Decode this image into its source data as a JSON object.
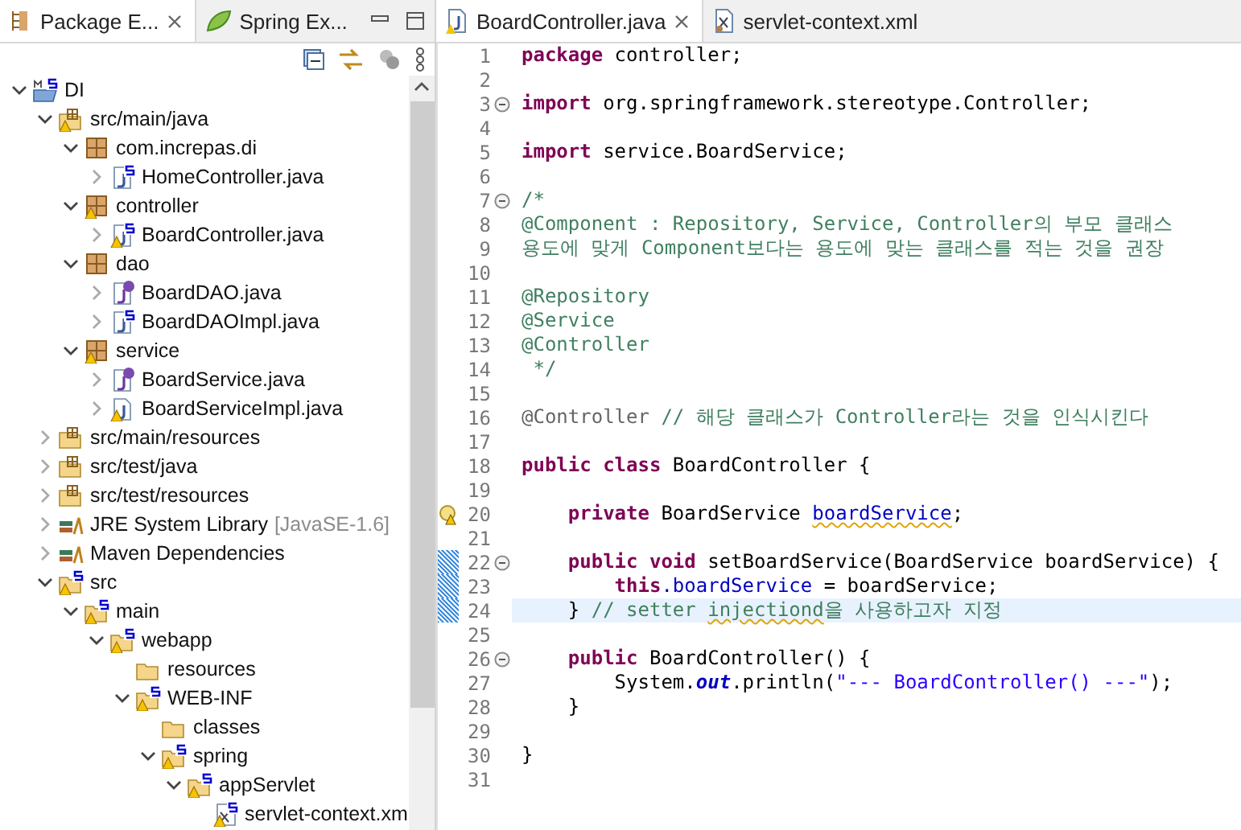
{
  "explorer": {
    "tabs": [
      {
        "label": "Package E...",
        "selected": true,
        "kind": "package"
      },
      {
        "label": "Spring Ex...",
        "selected": false,
        "kind": "spring"
      }
    ],
    "tree": [
      {
        "label": "DI",
        "kind": "project",
        "expanded": true,
        "children": [
          {
            "label": "src/main/java",
            "kind": "source-folder",
            "warning": true,
            "expanded": true,
            "children": [
              {
                "label": "com.increpas.di",
                "kind": "package",
                "expanded": true,
                "children": [
                  {
                    "label": "HomeController.java",
                    "kind": "java-class",
                    "expanded": false
                  }
                ]
              },
              {
                "label": "controller",
                "kind": "package",
                "warning": true,
                "expanded": true,
                "children": [
                  {
                    "label": "BoardController.java",
                    "kind": "java-class",
                    "warning": true,
                    "expanded": false
                  }
                ]
              },
              {
                "label": "dao",
                "kind": "package",
                "expanded": true,
                "children": [
                  {
                    "label": "BoardDAO.java",
                    "kind": "java-interface",
                    "expanded": false
                  },
                  {
                    "label": "BoardDAOImpl.java",
                    "kind": "java-class",
                    "expanded": false
                  }
                ]
              },
              {
                "label": "service",
                "kind": "package",
                "warning": true,
                "expanded": true,
                "children": [
                  {
                    "label": "BoardService.java",
                    "kind": "java-interface",
                    "expanded": false
                  },
                  {
                    "label": "BoardServiceImpl.java",
                    "kind": "java-file",
                    "warning": true,
                    "expanded": false
                  }
                ]
              }
            ]
          },
          {
            "label": "src/main/resources",
            "kind": "source-folder",
            "expanded": false
          },
          {
            "label": "src/test/java",
            "kind": "source-folder",
            "expanded": false
          },
          {
            "label": "src/test/resources",
            "kind": "source-folder",
            "expanded": false
          },
          {
            "label": "JRE System Library",
            "decoration": "[JavaSE-1.6]",
            "kind": "library",
            "expanded": false
          },
          {
            "label": "Maven Dependencies",
            "kind": "library",
            "expanded": false
          },
          {
            "label": "src",
            "kind": "spring-folder",
            "warning": true,
            "expanded": true,
            "children": [
              {
                "label": "main",
                "kind": "spring-folder",
                "warning": true,
                "expanded": true,
                "children": [
                  {
                    "label": "webapp",
                    "kind": "spring-folder",
                    "warning": true,
                    "expanded": true,
                    "children": [
                      {
                        "label": "resources",
                        "kind": "folder"
                      },
                      {
                        "label": "WEB-INF",
                        "kind": "spring-folder",
                        "warning": true,
                        "expanded": true,
                        "children": [
                          {
                            "label": "classes",
                            "kind": "folder"
                          },
                          {
                            "label": "spring",
                            "kind": "spring-folder",
                            "warning": true,
                            "expanded": true,
                            "children": [
                              {
                                "label": "appServlet",
                                "kind": "spring-folder",
                                "warning": true,
                                "expanded": true,
                                "children": [
                                  {
                                    "label": "servlet-context.xm",
                                    "kind": "xml",
                                    "warning": true
                                  }
                                ]
                              }
                            ]
                          }
                        ]
                      }
                    ]
                  }
                ]
              }
            ]
          }
        ]
      }
    ]
  },
  "editor": {
    "tabs": [
      {
        "label": "BoardController.java",
        "selected": true,
        "kind": "java"
      },
      {
        "label": "servlet-context.xml",
        "selected": false,
        "kind": "xml"
      }
    ],
    "lines": [
      {
        "number": "1",
        "tokens": [
          {
            "kind": "keyword",
            "text": "package"
          },
          {
            "kind": "plain",
            "text": " controller;"
          }
        ]
      },
      {
        "number": "2"
      },
      {
        "number": "3",
        "fold": true,
        "tokens": [
          {
            "kind": "keyword",
            "text": "import"
          },
          {
            "kind": "plain",
            "text": " org.springframework.stereotype.Controller;"
          }
        ]
      },
      {
        "number": "4"
      },
      {
        "number": "5",
        "tokens": [
          {
            "kind": "keyword",
            "text": "import"
          },
          {
            "kind": "plain",
            "text": " service.BoardService;"
          }
        ]
      },
      {
        "number": "6"
      },
      {
        "number": "7",
        "fold": true,
        "tokens": [
          {
            "kind": "comment",
            "text": "/*"
          }
        ]
      },
      {
        "number": "8",
        "tokens": [
          {
            "kind": "comment",
            "text": "@Component : Repository, Service, Controller의 부모 클래스"
          }
        ]
      },
      {
        "number": "9",
        "tokens": [
          {
            "kind": "comment",
            "text": "용도에 맞게 Component보다는 용도에 맞는 클래스를 적는 것을 권장"
          }
        ]
      },
      {
        "number": "10"
      },
      {
        "number": "11",
        "tokens": [
          {
            "kind": "comment",
            "text": "@Repository"
          }
        ]
      },
      {
        "number": "12",
        "tokens": [
          {
            "kind": "comment",
            "text": "@Service"
          }
        ]
      },
      {
        "number": "13",
        "tokens": [
          {
            "kind": "comment",
            "text": "@Controller"
          }
        ]
      },
      {
        "number": "14",
        "tokens": [
          {
            "kind": "comment",
            "text": " */"
          }
        ]
      },
      {
        "number": "15"
      },
      {
        "number": "16",
        "tokens": [
          {
            "kind": "annotation",
            "text": "@Controller"
          },
          {
            "kind": "comment",
            "text": " // 해당 클래스가 Controller라는 것을 인식시킨다"
          }
        ]
      },
      {
        "number": "17"
      },
      {
        "number": "18",
        "tokens": [
          {
            "kind": "keyword",
            "text": "public class"
          },
          {
            "kind": "plain",
            "text": " BoardController {"
          }
        ]
      },
      {
        "number": "19"
      },
      {
        "number": "20",
        "warning": true,
        "tokens": [
          {
            "kind": "keyword",
            "text": "    private"
          },
          {
            "kind": "plain",
            "text": " BoardService "
          },
          {
            "kind": "field",
            "text": "boardService",
            "squiggle": true
          },
          {
            "kind": "plain",
            "text": ";"
          }
        ]
      },
      {
        "number": "21"
      },
      {
        "number": "22",
        "fold": true,
        "change": true,
        "tokens": [
          {
            "kind": "keyword",
            "text": "    public void"
          },
          {
            "kind": "plain",
            "text": " setBoardService(BoardService boardService) {"
          }
        ]
      },
      {
        "number": "23",
        "change": true,
        "tokens": [
          {
            "kind": "keyword",
            "text": "        this"
          },
          {
            "kind": "field",
            "text": ".boardService"
          },
          {
            "kind": "plain",
            "text": " = boardService;"
          }
        ]
      },
      {
        "number": "24",
        "change": true,
        "current": true,
        "tokens": [
          {
            "kind": "plain",
            "text": "    } "
          },
          {
            "kind": "comment",
            "text": "// setter "
          },
          {
            "kind": "comment",
            "text": "injectiond",
            "squiggle": true
          },
          {
            "kind": "comment",
            "text": "을 사용하고자 지정"
          }
        ]
      },
      {
        "number": "25"
      },
      {
        "number": "26",
        "fold": true,
        "tokens": [
          {
            "kind": "keyword",
            "text": "    public"
          },
          {
            "kind": "plain",
            "text": " BoardController() {"
          }
        ]
      },
      {
        "number": "27",
        "tokens": [
          {
            "kind": "plain",
            "text": "        System."
          },
          {
            "kind": "static",
            "text": "out"
          },
          {
            "kind": "plain",
            "text": ".println("
          },
          {
            "kind": "string",
            "text": "\"--- BoardController() ---\""
          },
          {
            "kind": "plain",
            "text": ");"
          }
        ]
      },
      {
        "number": "28",
        "tokens": [
          {
            "kind": "plain",
            "text": "    }"
          }
        ]
      },
      {
        "number": "29"
      },
      {
        "number": "30",
        "tokens": [
          {
            "kind": "plain",
            "text": "}"
          }
        ]
      },
      {
        "number": "31"
      }
    ]
  }
}
